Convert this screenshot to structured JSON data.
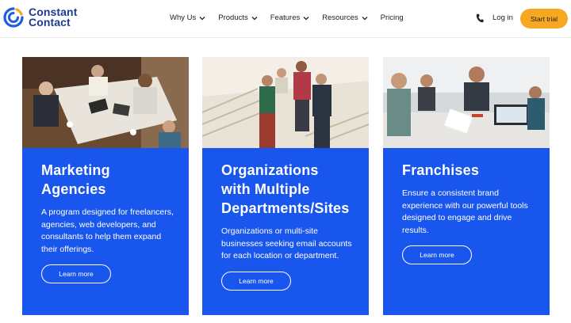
{
  "header": {
    "logo_line1": "Constant",
    "logo_line2": "Contact",
    "nav": [
      {
        "label": "Why Us"
      },
      {
        "label": "Products"
      },
      {
        "label": "Features"
      },
      {
        "label": "Resources"
      },
      {
        "label": "Pricing"
      }
    ],
    "login_label": "Log in",
    "cta_label": "Start trial"
  },
  "cards": [
    {
      "title_lines": [
        "Marketing",
        "Agencies"
      ],
      "description": "A program designed for freelancers, agencies, web developers, and consultants to help them expand their offerings.",
      "button": "Learn more"
    },
    {
      "title_lines": [
        "Organizations",
        "with Multiple",
        "Departments/Sites"
      ],
      "description": "Organizations or multi-site businesses seeking email accounts for each location or department.",
      "button": "Learn more"
    },
    {
      "title_lines": [
        "Franchises"
      ],
      "description": "Ensure a consistent brand experience with our powerful tools designed to engage and drive results.",
      "button": "Learn more"
    }
  ],
  "colors": {
    "card_blue": "#1856ed",
    "cta_orange": "#f7a823",
    "logo_blue": "#1d3b8f"
  },
  "icons": {
    "logo": "constant-contact-logo-icon",
    "chevron": "chevron-down-icon",
    "phone": "phone-icon"
  }
}
